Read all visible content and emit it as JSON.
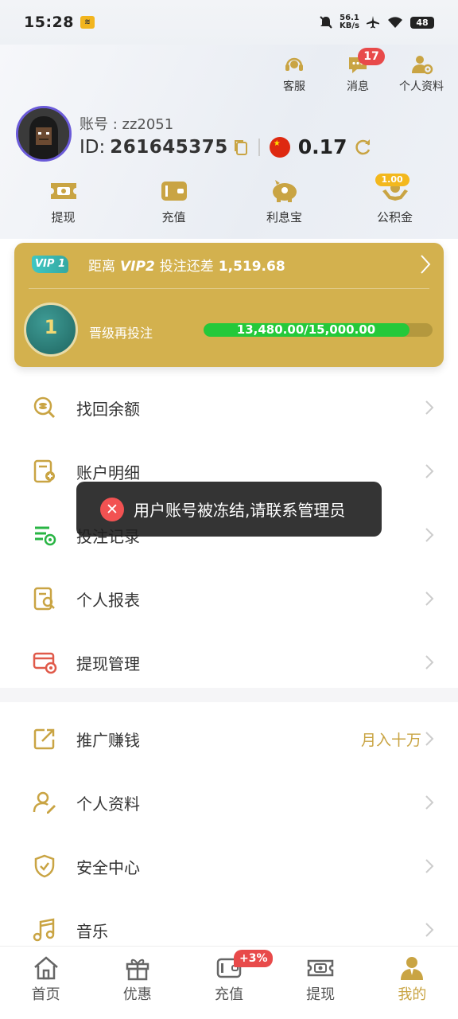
{
  "status_bar": {
    "time": "15:28",
    "net_speed_value": "56.1",
    "net_speed_unit": "KB/s",
    "battery": "48"
  },
  "header": {
    "actions": [
      {
        "label": "客服",
        "icon": "headset-icon"
      },
      {
        "label": "消息",
        "icon": "message-icon",
        "badge": "17"
      },
      {
        "label": "个人资料",
        "icon": "user-settings-icon"
      }
    ],
    "account_label": "账号 : zz2051",
    "id_prefix": "ID:",
    "id_value": "261645375",
    "balance": "0.17",
    "quick_actions": [
      {
        "label": "提现",
        "icon": "ticket-icon"
      },
      {
        "label": "充值",
        "icon": "wallet-icon"
      },
      {
        "label": "利息宝",
        "icon": "piggy-bank-icon"
      },
      {
        "label": "公积金",
        "icon": "hands-coin-icon",
        "badge": "1.00"
      }
    ]
  },
  "vip": {
    "tag": "VIP 1",
    "text_prefix": "距离",
    "next_level": "VIP2",
    "text_mid": "投注还差",
    "remaining": "1,519.68",
    "medal_level": "1",
    "progress_label": "晋级再投注",
    "progress_text": "13,480.00/15,000.00",
    "progress_fraction": 0.8987
  },
  "menu_group1": [
    {
      "label": "找回余额",
      "icon": "coin-search-icon"
    },
    {
      "label": "账户明细",
      "icon": "account-detail-icon"
    },
    {
      "label": "投注记录",
      "icon": "bet-record-icon"
    },
    {
      "label": "个人报表",
      "icon": "report-icon"
    },
    {
      "label": "提现管理",
      "icon": "withdraw-manage-icon"
    }
  ],
  "menu_group2": [
    {
      "label": "推广赚钱",
      "icon": "share-icon",
      "extra": "月入十万"
    },
    {
      "label": "个人资料",
      "icon": "profile-edit-icon"
    },
    {
      "label": "安全中心",
      "icon": "shield-icon"
    },
    {
      "label": "音乐",
      "icon": "music-icon"
    }
  ],
  "toast": {
    "text": "用户账号被冻结,请联系管理员"
  },
  "tabbar": [
    {
      "label": "首页",
      "icon": "home-icon"
    },
    {
      "label": "优惠",
      "icon": "gift-icon"
    },
    {
      "label": "充值",
      "icon": "wallet-icon",
      "badge": "+3%"
    },
    {
      "label": "提现",
      "icon": "ticket-icon"
    },
    {
      "label": "我的",
      "icon": "user-icon",
      "active": true
    }
  ],
  "colors": {
    "gold": "#c9a443",
    "vip_card": "#d3b14e",
    "progress": "#24c93a",
    "badge_red": "#e84a4a"
  }
}
